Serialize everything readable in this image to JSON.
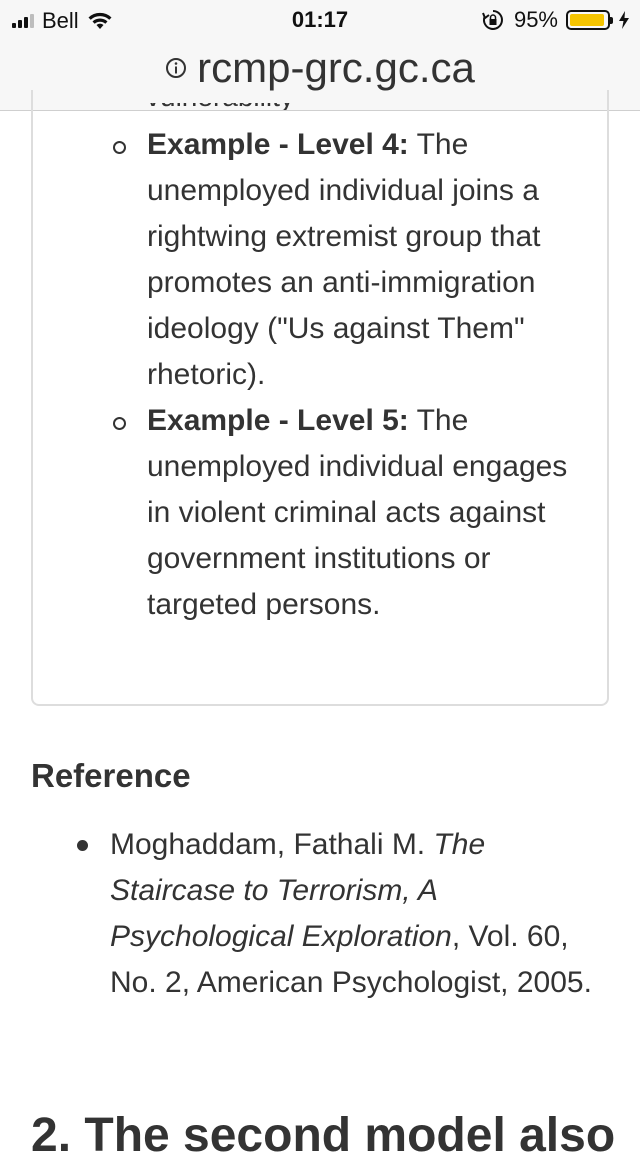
{
  "status_bar": {
    "carrier": "Bell",
    "time": "01:17",
    "battery_percent": "95%",
    "battery_level": 0.95,
    "battery_color": "#f5c400"
  },
  "browser": {
    "url": "rcmp-grc.gc.ca"
  },
  "content": {
    "partial_line": "vulnerability",
    "examples": [
      {
        "label": "Example - Level 4:",
        "text": " The unemployed individual joins a rightwing extremist group that promotes an anti-immigration ideology (\"Us against Them\" rhetoric)."
      },
      {
        "label": "Example - Level 5:",
        "text": " The unemployed individual engages in violent criminal acts against government institutions or targeted persons."
      }
    ],
    "reference": {
      "heading": "Reference",
      "author": "Moghaddam, Fathali M. ",
      "title": "The Staircase to Terrorism, A Psychological Exploration",
      "rest": ", Vol. 60, No. 2, American Psychologist, 2005."
    },
    "next_heading": "2. The second model also"
  }
}
